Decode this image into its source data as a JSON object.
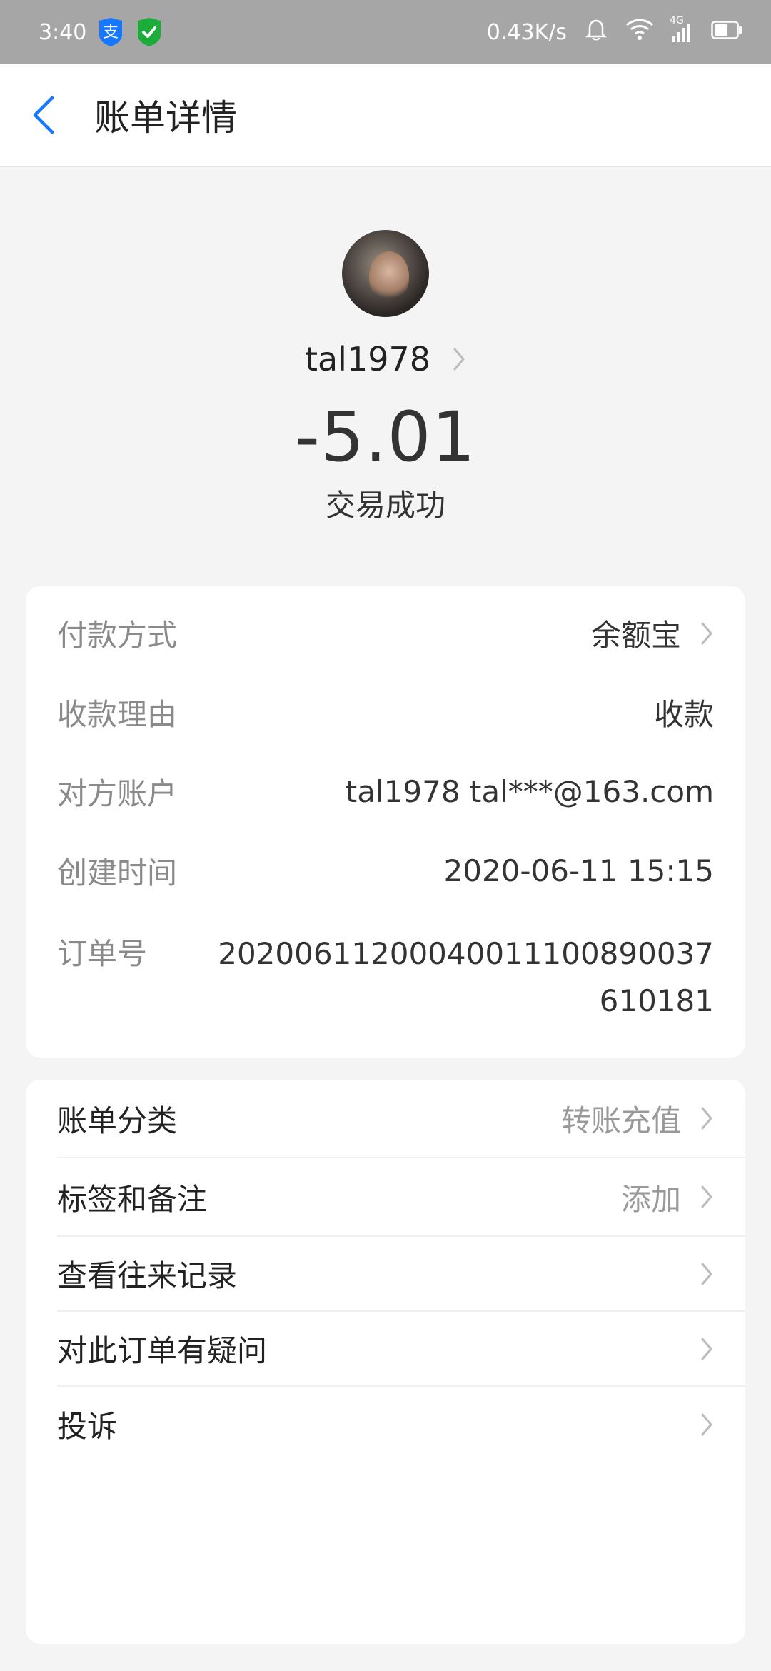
{
  "status_bar": {
    "time": "3:40",
    "net_speed": "0.43K/s",
    "network_type": "4G",
    "icons": [
      "alipay-icon",
      "shield-check-icon",
      "bell-icon",
      "wifi-icon",
      "signal-icon",
      "battery-icon"
    ]
  },
  "header": {
    "title": "账单详情"
  },
  "profile": {
    "name": "tal1978",
    "amount": "-5.01",
    "status": "交易成功"
  },
  "details": {
    "rows": [
      {
        "label": "付款方式",
        "value": "余额宝"
      },
      {
        "label": "收款理由",
        "value": "收款"
      },
      {
        "label": "对方账户",
        "value": "tal1978 tal***@163.com"
      },
      {
        "label": "创建时间",
        "value": "2020-06-11 15:15"
      },
      {
        "label": "订单号",
        "value": "20200611200040011100890037610181"
      }
    ]
  },
  "actions": {
    "rows": [
      {
        "label": "账单分类",
        "hint": "转账充值"
      },
      {
        "label": "标签和备注",
        "hint": "添加"
      },
      {
        "label": "查看往来记录"
      },
      {
        "label": "对此订单有疑问"
      },
      {
        "label": "投诉"
      }
    ]
  },
  "colors": {
    "accent": "#1677ff",
    "status_bar_bg": "#a6a6a6",
    "page_bg": "#f4f4f4",
    "shield_green": "#1aad3a"
  }
}
